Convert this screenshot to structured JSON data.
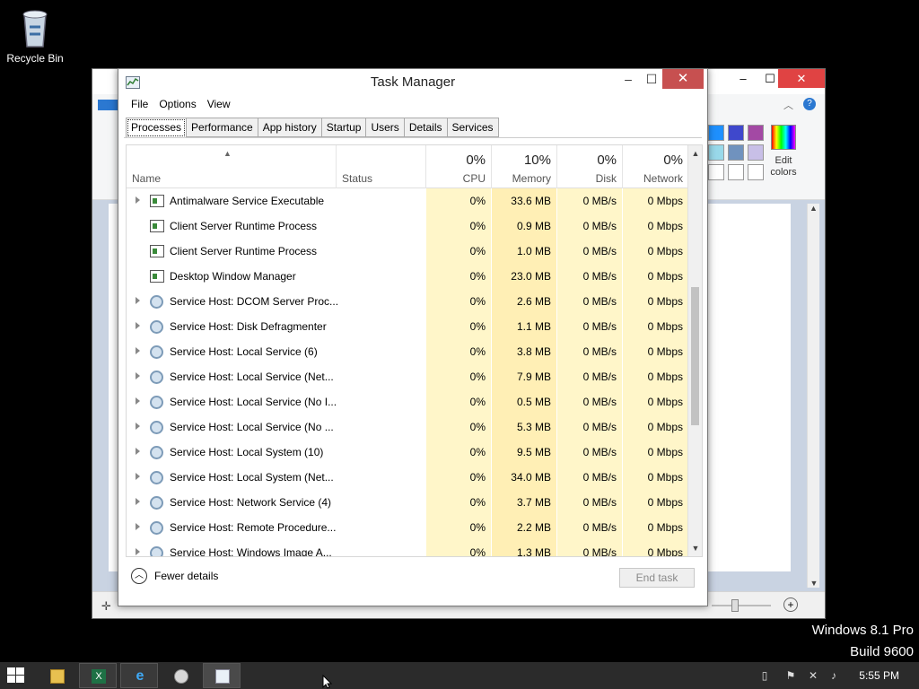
{
  "desktop": {
    "recycle_bin_label": "Recycle Bin",
    "watermark_line1": "Windows 8.1 Pro",
    "watermark_line2": "Build 9600"
  },
  "paint": {
    "edit_colors_label_1": "Edit",
    "edit_colors_label_2": "colors",
    "palette": [
      "#1e90ff",
      "#3f48cc",
      "#a349a4",
      "#99d9ea",
      "#7092be",
      "#c8bfe7"
    ]
  },
  "taskmanager": {
    "title": "Task Manager",
    "menu": [
      "File",
      "Options",
      "View"
    ],
    "tabs": [
      "Processes",
      "Performance",
      "App history",
      "Startup",
      "Users",
      "Details",
      "Services"
    ],
    "active_tab": "Processes",
    "columns": {
      "name": "Name",
      "status": "Status",
      "cpu": {
        "pct": "0%",
        "label": "CPU"
      },
      "memory": {
        "pct": "10%",
        "label": "Memory"
      },
      "disk": {
        "pct": "0%",
        "label": "Disk"
      },
      "network": {
        "pct": "0%",
        "label": "Network"
      }
    },
    "processes": [
      {
        "name": "Antimalware Service Executable",
        "icon": "app",
        "expand": true,
        "cpu": "0%",
        "mem": "33.6 MB",
        "disk": "0 MB/s",
        "net": "0 Mbps"
      },
      {
        "name": "Client Server Runtime Process",
        "icon": "app",
        "expand": false,
        "cpu": "0%",
        "mem": "0.9 MB",
        "disk": "0 MB/s",
        "net": "0 Mbps"
      },
      {
        "name": "Client Server Runtime Process",
        "icon": "app",
        "expand": false,
        "cpu": "0%",
        "mem": "1.0 MB",
        "disk": "0 MB/s",
        "net": "0 Mbps"
      },
      {
        "name": "Desktop Window Manager",
        "icon": "app",
        "expand": false,
        "cpu": "0%",
        "mem": "23.0 MB",
        "disk": "0 MB/s",
        "net": "0 Mbps"
      },
      {
        "name": "Service Host: DCOM Server Proc...",
        "icon": "svc",
        "expand": true,
        "cpu": "0%",
        "mem": "2.6 MB",
        "disk": "0 MB/s",
        "net": "0 Mbps"
      },
      {
        "name": "Service Host: Disk Defragmenter",
        "icon": "svc",
        "expand": true,
        "cpu": "0%",
        "mem": "1.1 MB",
        "disk": "0 MB/s",
        "net": "0 Mbps"
      },
      {
        "name": "Service Host: Local Service (6)",
        "icon": "svc",
        "expand": true,
        "cpu": "0%",
        "mem": "3.8 MB",
        "disk": "0 MB/s",
        "net": "0 Mbps"
      },
      {
        "name": "Service Host: Local Service (Net...",
        "icon": "svc",
        "expand": true,
        "cpu": "0%",
        "mem": "7.9 MB",
        "disk": "0 MB/s",
        "net": "0 Mbps"
      },
      {
        "name": "Service Host: Local Service (No I...",
        "icon": "svc",
        "expand": true,
        "cpu": "0%",
        "mem": "0.5 MB",
        "disk": "0 MB/s",
        "net": "0 Mbps"
      },
      {
        "name": "Service Host: Local Service (No ...",
        "icon": "svc",
        "expand": true,
        "cpu": "0%",
        "mem": "5.3 MB",
        "disk": "0 MB/s",
        "net": "0 Mbps"
      },
      {
        "name": "Service Host: Local System (10)",
        "icon": "svc",
        "expand": true,
        "cpu": "0%",
        "mem": "9.5 MB",
        "disk": "0 MB/s",
        "net": "0 Mbps"
      },
      {
        "name": "Service Host: Local System (Net...",
        "icon": "svc",
        "expand": true,
        "cpu": "0%",
        "mem": "34.0 MB",
        "disk": "0 MB/s",
        "net": "0 Mbps"
      },
      {
        "name": "Service Host: Network Service (4)",
        "icon": "svc",
        "expand": true,
        "cpu": "0%",
        "mem": "3.7 MB",
        "disk": "0 MB/s",
        "net": "0 Mbps"
      },
      {
        "name": "Service Host: Remote Procedure...",
        "icon": "svc",
        "expand": true,
        "cpu": "0%",
        "mem": "2.2 MB",
        "disk": "0 MB/s",
        "net": "0 Mbps"
      },
      {
        "name": "Service Host: Windows Image A...",
        "icon": "svc",
        "expand": true,
        "cpu": "0%",
        "mem": "1.3 MB",
        "disk": "0 MB/s",
        "net": "0 Mbps"
      }
    ],
    "fewer_details": "Fewer details",
    "end_task": "End task"
  },
  "taskbar": {
    "clock": "5:55 PM",
    "pinned": [
      "file-explorer-icon",
      "excel-icon",
      "internet-explorer-icon",
      "paint-icon",
      "task-manager-icon"
    ]
  }
}
